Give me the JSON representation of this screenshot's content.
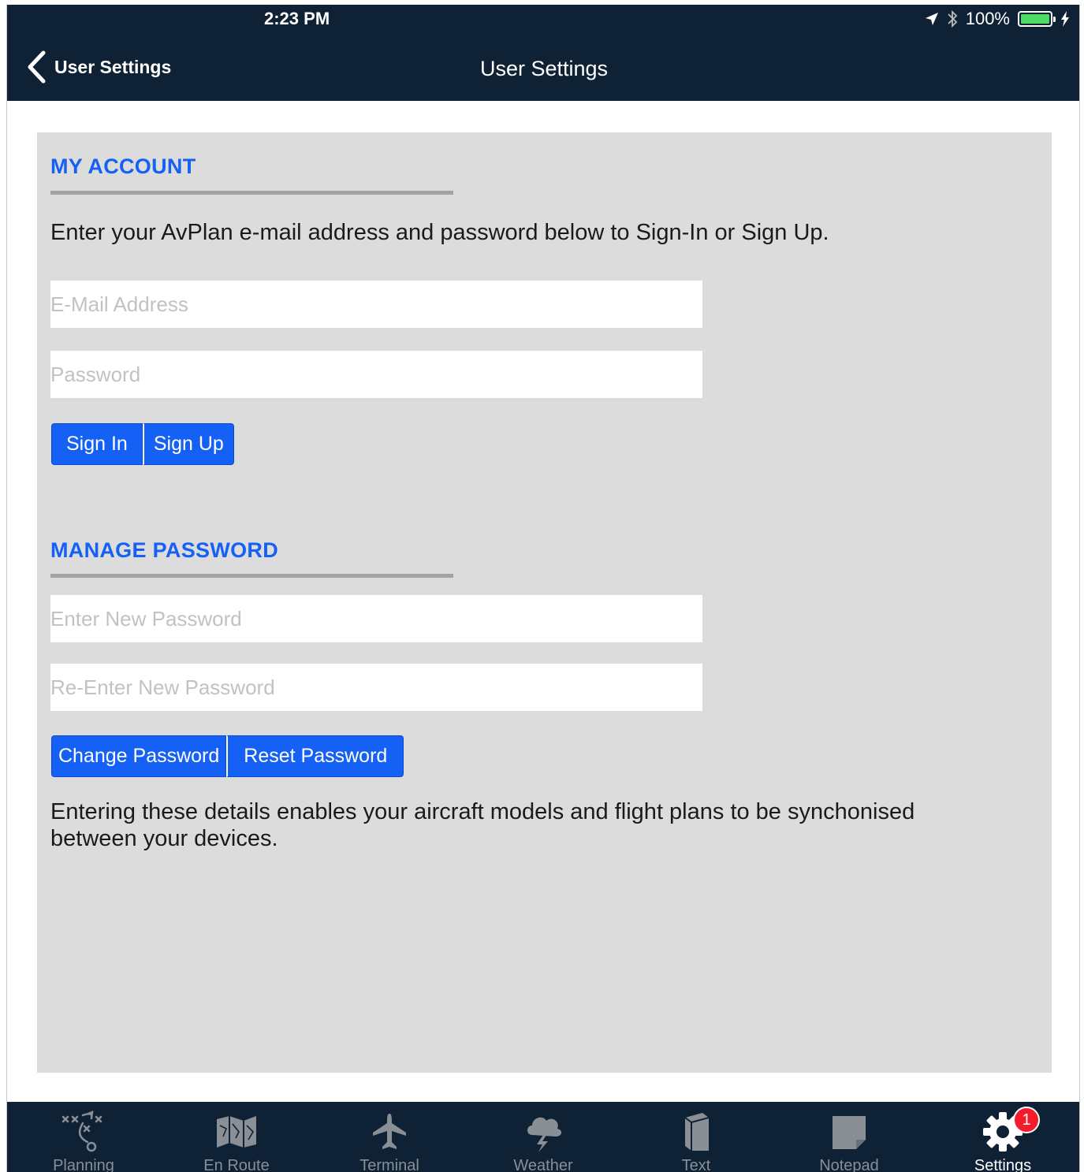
{
  "status_bar": {
    "time": "2:23 PM",
    "battery": "100%"
  },
  "nav": {
    "back_label": "User Settings",
    "title": "User Settings"
  },
  "my_account": {
    "title": "MY ACCOUNT",
    "instructions": "Enter your AvPlan e-mail address and password below to Sign-In or Sign Up.",
    "email_placeholder": "E-Mail Address",
    "password_placeholder": "Password",
    "sign_in_label": "Sign In",
    "sign_up_label": "Sign Up"
  },
  "manage_password": {
    "title": "MANAGE PASSWORD",
    "new_password_placeholder": "Enter New Password",
    "reenter_password_placeholder": "Re-Enter New Password",
    "change_label": "Change Password",
    "reset_label": "Reset Password",
    "note": "Entering these details enables your aircraft models and flight plans to be synchonised between your devices."
  },
  "tabs": [
    {
      "label": "Planning",
      "icon": "planning-icon"
    },
    {
      "label": "En Route",
      "icon": "map-icon"
    },
    {
      "label": "Terminal",
      "icon": "airplane-icon"
    },
    {
      "label": "Weather",
      "icon": "weather-icon"
    },
    {
      "label": "Text",
      "icon": "book-icon"
    },
    {
      "label": "Notepad",
      "icon": "notepad-icon"
    },
    {
      "label": "Settings",
      "icon": "gear-icon",
      "badge": "1",
      "active": true
    }
  ],
  "colors": {
    "bar": "#0e2135",
    "accent": "#1560f5",
    "panel": "#dcdcdc",
    "badge": "#f41c2c"
  }
}
